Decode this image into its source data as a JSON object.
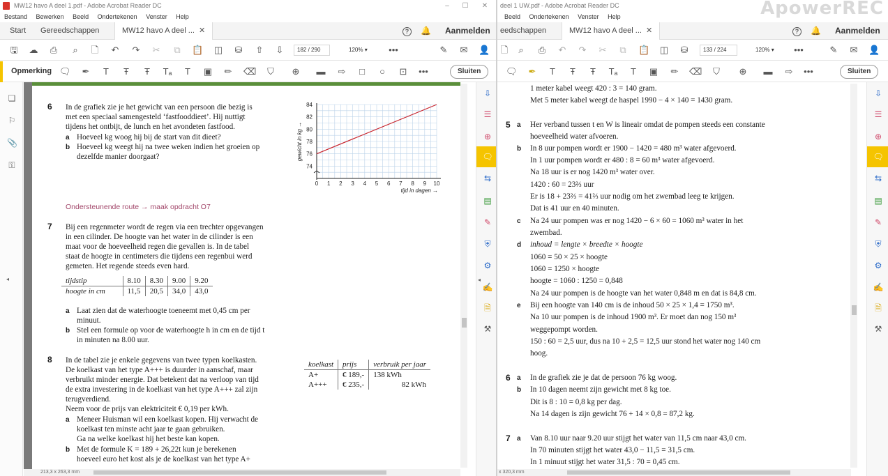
{
  "left": {
    "title": "MW12 havo A deel 1.pdf - Adobe Acrobat Reader DC",
    "menu": [
      "Bestand",
      "Bewerken",
      "Beeld",
      "Ondertekenen",
      "Venster",
      "Help"
    ],
    "tabs": {
      "start": "Start",
      "tools": "Gereedschappen",
      "doc": "MW12 havo A deel ...",
      "signin": "Aanmelden"
    },
    "page_num": "182",
    "page_total": "/ 290",
    "zoom": "120%",
    "ann_label": "Opmerking",
    "close": "Sluiten",
    "status": "213,3 x 263,3 mm",
    "q6": {
      "num": "6",
      "lines": [
        "In de grafiek zie je het gewicht van een persoon die bezig is",
        "met een speciaal samengesteld ‘fastfooddieet’. Hij nuttigt",
        "tijdens het ontbijt, de lunch en het avondeten fastfood."
      ],
      "a": "Hoeveel kg woog hij bij de start van dit dieet?",
      "b1": "Hoeveel kg weegt hij na twee weken indien het groeien op",
      "b2": "dezelfde manier doorgaat?"
    },
    "support": "Ondersteunende route → maak opdracht O7",
    "q7": {
      "num": "7",
      "lines": [
        "Bij een regenmeter wordt de regen via een trechter opgevangen",
        "in een cilinder. De hoogte van het water in de cilinder is een",
        "maat voor de hoeveelheid regen die gevallen is. In de tabel",
        "staat de hoogte in centimeters die tijdens een regenbui werd",
        "gemeten. Het regende steeds even hard."
      ],
      "table": {
        "h1": "tijdstip",
        "h2": "hoogte in cm",
        "times": [
          "8.10",
          "8.30",
          "9.00",
          "9.20"
        ],
        "heights": [
          "11,5",
          "20,5",
          "34,0",
          "43,0"
        ]
      },
      "a1": "Laat zien dat de waterhoogte toeneemt met 0,45 cm per",
      "a2": "minuut.",
      "b1": "Stel een formule op voor de waterhoogte h in cm en de tijd t",
      "b2": "in minuten na 8.00 uur."
    },
    "q8": {
      "num": "8",
      "lines": [
        "In de tabel zie je enkele gegevens van twee typen koelkasten.",
        "De koelkast van het type A+++ is duurder in aanschaf, maar",
        "verbruikt minder energie. Dat betekent dat na verloop van tijd",
        "de extra investering in de koelkast van het type A+++ zal zijn",
        "terugverdiend.",
        "Neem voor de prijs van elektriciteit € 0,19 per kWh."
      ],
      "a1": "Meneer Huisman wil een koelkast kopen. Hij verwacht de",
      "a2": "koelkast ten minste acht jaar te gaan gebruiken.",
      "a3": "Ga na welke koelkast hij het beste kan kopen.",
      "b1": "Met de formule K = 189 + 26,22t kun je berekenen",
      "b2": "hoeveel euro het kost als je de koelkast van het type A+",
      "table": {
        "h": [
          "koelkast",
          "prijs",
          "verbruik per jaar"
        ],
        "rows": [
          [
            "A+",
            "€ 189,-",
            "138 kWh"
          ],
          [
            "A+++",
            "€ 235,-",
            "82 kWh"
          ]
        ]
      }
    },
    "chart": {
      "ylabel": "gewicht in kg",
      "xlabel": "tijd in dagen"
    }
  },
  "chart_data": {
    "type": "line",
    "x": [
      0,
      10
    ],
    "series": [
      {
        "values": [
          76,
          84
        ]
      }
    ],
    "xticks": [
      "0",
      "1",
      "2",
      "3",
      "4",
      "5",
      "6",
      "7",
      "8",
      "9",
      "10"
    ],
    "yticks": [
      "74",
      "76",
      "78",
      "80",
      "82",
      "84"
    ],
    "xlim": [
      0,
      10
    ],
    "ylim": [
      72,
      84
    ],
    "xlabel": "tijd in dagen",
    "ylabel": "gewicht in kg",
    "grid": true
  },
  "right": {
    "title": "deel 1 UW.pdf - Adobe Acrobat Reader DC",
    "menu": [
      "Beeld",
      "Ondertekenen",
      "Venster",
      "Help"
    ],
    "tabs": {
      "tools": "eedschappen",
      "doc": "MW12 havo A deel ...",
      "signin": "Aanmelden"
    },
    "page_num": "133",
    "page_total": "/ 224",
    "zoom": "120%",
    "close": "Sluiten",
    "status": "x 320,3 mm",
    "watermark": "ApowerREC",
    "lines": [
      "1 meter kabel weegt 420 : 3 = 140 gram.",
      "Met 5 meter kabel weegt de haspel 1990 − 4 × 140 = 1430 gram.",
      "Her verband tussen t en W is lineair omdat de pompen steeds een constante",
      "hoeveelheid water afvoeren.",
      "In 8 uur pompen wordt er 1900 − 1420 = 480 m³ water afgevoerd.",
      "In 1 uur pompen wordt er 480 : 8 = 60 m³ water afgevoerd.",
      "Na 18 uur is er nog 1420 m³ water over.",
      "1420 : 60 = 23⅔ uur",
      "Er is 18 + 23⅔ = 41⅔ uur nodig om het zwembad leeg te krijgen.",
      "Dat is 41 uur en 40 minuten.",
      "Na 24 uur pompen was er nog 1420 − 6 × 60 = 1060 m³ water in het",
      "zwembad.",
      "inhoud = lengte × breedte × hoogte",
      "1060 = 50 × 25 × hoogte",
      "1060 = 1250 × hoogte",
      "hoogte = 1060 : 1250 = 0,848",
      "Na 24 uur pompen is de hoogte van het water 0,848 m en dat is 84,8 cm.",
      "Bij een hoogte van 140 cm is de inhoud 50 × 25 × 1,4 = 1750 m³.",
      "Na 10 uur pompen is de inhoud 1900 m³. Er moet dan nog 150 m³",
      "weggepompt worden.",
      "150 : 60 = 2,5 uur, dus na 10 + 2,5 = 12,5 uur stond het water nog 140 cm",
      "hoog.",
      "In de grafiek zie je dat de persoon 76 kg woog.",
      "In 10 dagen neemt zijn gewicht met 8 kg toe.",
      "Dit is 8 : 10 = 0,8 kg per dag.",
      "Na 14 dagen is zijn gewicht 76 + 14 × 0,8 = 87,2 kg.",
      "Van 8.10 uur naar 9.20 uur stijgt het water van 11,5 cm naar 43,0 cm.",
      "In 70 minuten stijgt het water 43,0 − 11,5 = 31,5 cm.",
      "In 1 minuut stijgt het water 31,5 : 70 = 0,45 cm."
    ],
    "labels": {
      "n5": "5",
      "n6": "6",
      "n7": "7",
      "a": "a",
      "b": "b",
      "c": "c",
      "d": "d",
      "e": "e"
    }
  }
}
